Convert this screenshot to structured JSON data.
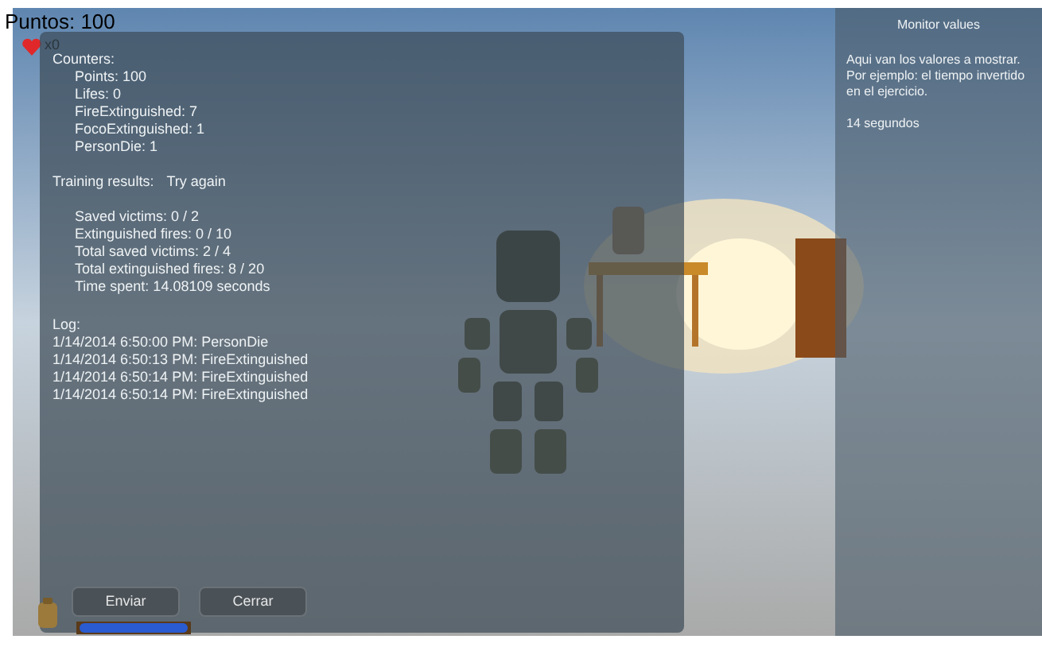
{
  "score": "Puntos: 100",
  "lives": "x0",
  "counters": {
    "title": "Counters:",
    "items": [
      "Points: 100",
      "Lifes: 0",
      "FireExtinguished: 7",
      "FocoExtinguished: 1",
      "PersonDie: 1"
    ]
  },
  "training": {
    "title": "Training results:",
    "result": "Try again",
    "items": [
      "Saved victims: 0 / 2",
      "Extinguished fires: 0 / 10",
      "Total saved victims: 2 / 4",
      "Total extinguished fires: 8 / 20",
      "Time spent: 14.08109 seconds"
    ]
  },
  "log": {
    "title": "Log:",
    "entries": [
      "1/14/2014 6:50:00 PM: PersonDie",
      "1/14/2014 6:50:13 PM: FireExtinguished",
      "1/14/2014 6:50:14 PM: FireExtinguished",
      "1/14/2014 6:50:14 PM: FireExtinguished"
    ]
  },
  "buttons": [
    {
      "label": "Enviar"
    },
    {
      "label": "Cerrar"
    }
  ],
  "monitor": {
    "title": "Monitor values",
    "lines": [
      "Aqui van los valores a mostrar.",
      "Por ejemplo: el tiempo invertido en el ejercicio."
    ],
    "time": "14 segundos"
  }
}
